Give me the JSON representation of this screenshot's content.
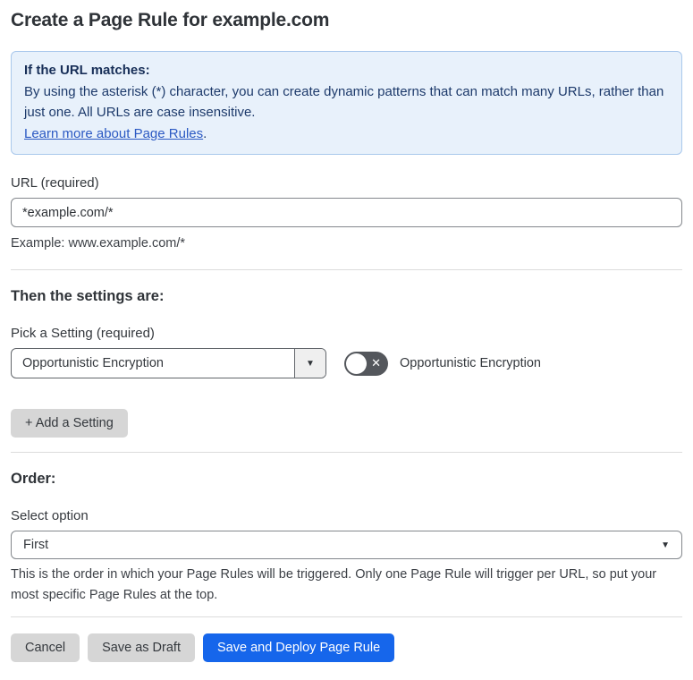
{
  "page": {
    "title": "Create a Page Rule for example.com"
  },
  "info_box": {
    "heading": "If the URL matches:",
    "body": "By using the asterisk (*) character, you can create dynamic patterns that can match many URLs, rather than just one. All URLs are case insensitive.",
    "link_label": "Learn more about Page Rules",
    "link_suffix": "."
  },
  "url_field": {
    "label": "URL (required)",
    "value": "*example.com/*",
    "helper": "Example: www.example.com/*"
  },
  "settings_section": {
    "heading": "Then the settings are:",
    "picker_label": "Pick a Setting (required)",
    "picker_value": "Opportunistic Encryption",
    "toggle_state": "off",
    "toggle_label": "Opportunistic Encryption",
    "add_setting_label": "+ Add a Setting"
  },
  "order_section": {
    "heading": "Order:",
    "select_label": "Select option",
    "select_value": "First",
    "helper": "This is the order in which your Page Rules will be triggered. Only one Page Rule will trigger per URL, so put your most specific Page Rules at the top."
  },
  "footer": {
    "cancel_label": "Cancel",
    "save_draft_label": "Save as Draft",
    "deploy_label": "Save and Deploy Page Rule"
  },
  "icons": {
    "dropdown_arrow": "▼",
    "toggle_off_glyph": "✕"
  },
  "colors": {
    "info_background": "#e8f1fb",
    "info_border": "#a9c8ec",
    "info_text": "#1d3a6b",
    "link_blue": "#2b59c3",
    "primary_button_blue": "#1666eb",
    "secondary_button_gray": "#d6d6d6",
    "toggle_off_gray": "#54575c"
  }
}
